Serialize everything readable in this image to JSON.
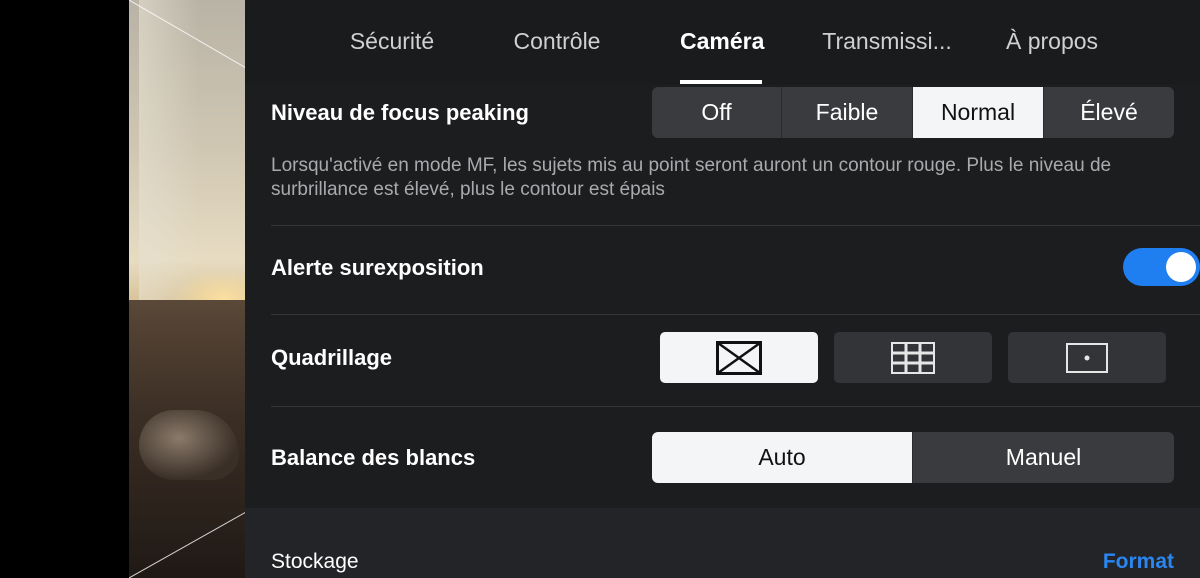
{
  "tabs": [
    {
      "label": "Sécurité",
      "active": false
    },
    {
      "label": "Contrôle",
      "active": false
    },
    {
      "label": "Caméra",
      "active": true
    },
    {
      "label": "Transmissi...",
      "active": false
    },
    {
      "label": "À propos",
      "active": false
    }
  ],
  "focus_peaking": {
    "label": "Niveau de focus peaking",
    "options": [
      "Off",
      "Faible",
      "Normal",
      "Élevé"
    ],
    "selected": "Normal",
    "description": "Lorsqu'activé en mode MF, les sujets mis au point seront auront un contour rouge. Plus le niveau de surbrillance est élevé, plus le contour est épais"
  },
  "overexposure": {
    "label": "Alerte surexposition",
    "enabled": true
  },
  "grid": {
    "label": "Quadrillage",
    "options": [
      {
        "icon": "grid-diagonal-icon",
        "selected": true
      },
      {
        "icon": "grid-thirds-icon",
        "selected": false
      },
      {
        "icon": "grid-center-point-icon",
        "selected": false
      }
    ]
  },
  "white_balance": {
    "label": "Balance des blancs",
    "options": [
      "Auto",
      "Manuel"
    ],
    "selected": "Auto"
  },
  "storage": {
    "label": "Stockage",
    "action": "Format"
  },
  "colors": {
    "accent": "#1f7ef0",
    "link": "#2a86f0",
    "panel": "#1c1d1f",
    "selected_segment": "#f4f5f7"
  }
}
